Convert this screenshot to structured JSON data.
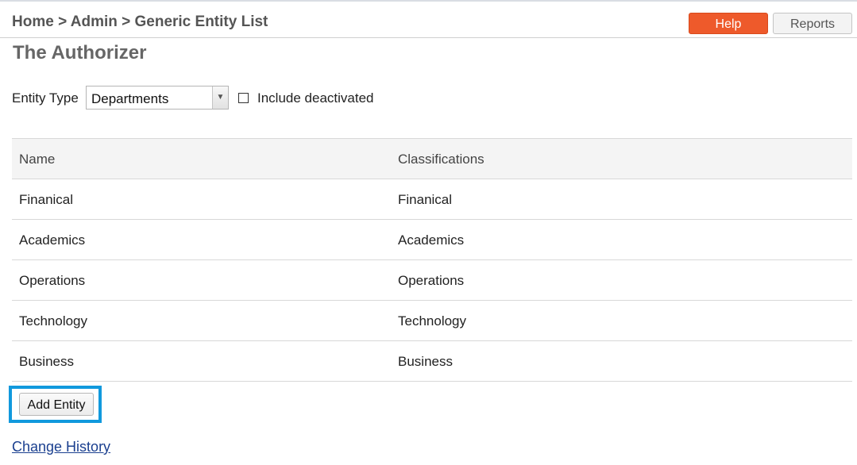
{
  "header": {
    "breadcrumb": "Home > Admin > Generic Entity List",
    "help_label": "Help",
    "reports_label": "Reports"
  },
  "page": {
    "title": "The Authorizer"
  },
  "filters": {
    "entity_type_label": "Entity Type",
    "entity_type_value": "Departments",
    "include_deactivated_label": "Include deactivated",
    "include_deactivated_checked": false
  },
  "table": {
    "columns": [
      "Name",
      "Classifications"
    ],
    "rows": [
      [
        "Finanical",
        "Finanical"
      ],
      [
        "Academics",
        "Academics"
      ],
      [
        "Operations",
        "Operations"
      ],
      [
        "Technology",
        "Technology"
      ],
      [
        "Business",
        "Business"
      ]
    ]
  },
  "actions": {
    "add_entity_label": "Add Entity",
    "change_history_label": "Change History"
  },
  "colors": {
    "help_button": "#ee5a2b",
    "highlight": "#1199dd",
    "link": "#1a3f8f"
  },
  "icons": {
    "select_arrow": "chevron-down-icon"
  }
}
